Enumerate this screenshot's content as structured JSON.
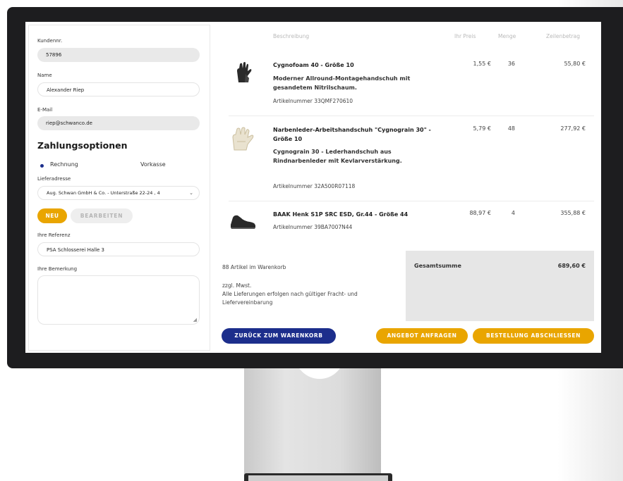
{
  "form": {
    "customer_no_label": "Kundennr.",
    "customer_no": "57896",
    "name_label": "Name",
    "name": "Alexander Riep",
    "email_label": "E-Mail",
    "email": "riep@schwanco.de",
    "payment_title": "Zahlungsoptionen",
    "payment_options": [
      "Rechnung",
      "Vorkasse"
    ],
    "payment_selected": "Rechnung",
    "address_label": "Lieferadresse",
    "address_value": "Aug. Schwan GmbH & Co. - Unterstraße 22-24 , 4",
    "new_button": "NEU",
    "edit_button": "BEARBEITEN",
    "reference_label": "Ihre Referenz",
    "reference_value": "PSA Schlosserei Halle 3",
    "remark_label": "Ihre Bemerkung",
    "remark_value": ""
  },
  "table": {
    "headers": [
      "Beschreibung",
      "Ihr Preis",
      "Menge",
      "Zeilenbetrag"
    ],
    "rows": [
      {
        "icon": "black-work-glove-icon",
        "title": "Cygnofoam 40 - Größe 10",
        "desc": "Moderner Allround-Montagehandschuh mit gesandetem Nitrilschaum.",
        "article": "Artikelnummer 33QMF270610",
        "price": "1,55 €",
        "qty": "36",
        "total": "55,80 €"
      },
      {
        "icon": "leather-work-glove-icon",
        "title": "Narbenleder-Arbeitshandschuh \"Cygnograin 30\" - Größe 10",
        "desc": "Cygnograin 30 - Lederhandschuh aus Rindnarbenleder mit Kevlarverstärkung.",
        "article": "Artikelnummer 32A500R07118",
        "price": "5,79 €",
        "qty": "48",
        "total": "277,92 €"
      },
      {
        "icon": "safety-shoe-icon",
        "title": "BAAK Henk S1P SRC ESD, Gr.44 - Größe 44",
        "desc": "",
        "article": "Artikelnummer 39BA7007N44",
        "price": "88,97 €",
        "qty": "4",
        "total": "355,88 €"
      }
    ]
  },
  "summary": {
    "items_in_cart": "88 Artikel im Warenkorb",
    "vat": "zzgl. Mwst.",
    "delivery_note": "Alle Lieferungen erfolgen nach gültiger Fracht- und Liefervereinbarung",
    "total_label": "Gesamtsumme",
    "total_value": "689,60 €"
  },
  "actions": {
    "back": "ZURÜCK ZUM WARENKORB",
    "quote": "ANGEBOT ANFRAGEN",
    "order": "BESTELLUNG ABSCHLIESSEN"
  },
  "colors": {
    "accent_yellow": "#e9a500",
    "accent_blue": "#1c2e8c",
    "bezel": "#1d1d1f"
  }
}
